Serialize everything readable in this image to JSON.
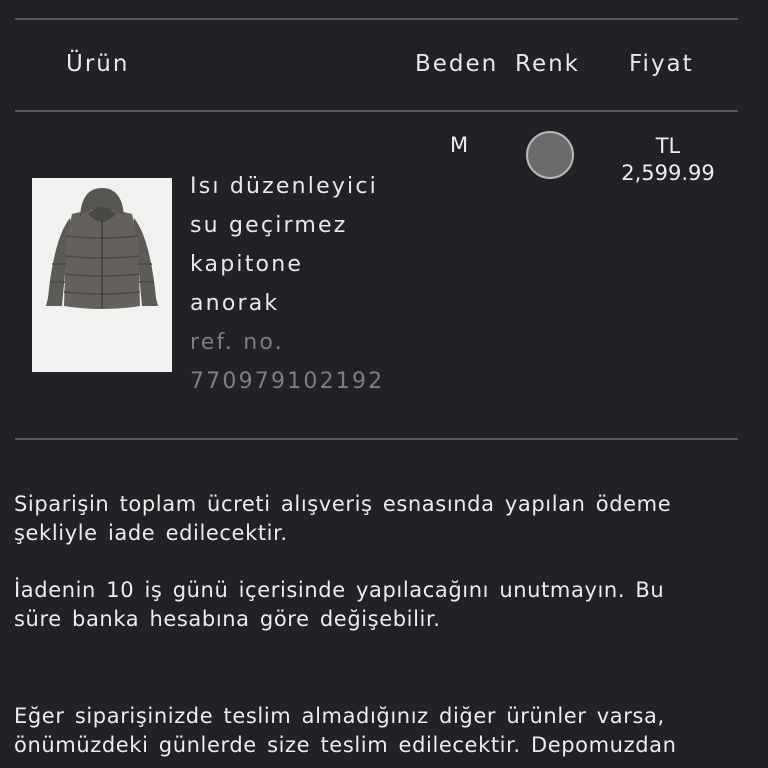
{
  "table": {
    "headers": {
      "product": "Ürün",
      "size": "Beden",
      "color": "Renk",
      "price": "Fiyat"
    }
  },
  "item": {
    "image_icon": "hooded-puffer-jacket",
    "name_lines": [
      "Isı düzenleyici",
      "su geçirmez",
      "kapitone",
      "anorak"
    ],
    "ref_label": "ref. no.",
    "ref_number": "770979102192",
    "size": "M",
    "color_swatch": "#6a6a6c",
    "currency": "TL",
    "price": "2,599.99"
  },
  "info": {
    "para1_line1": "Siparişin toplam ücreti alışveriş esnasında yapılan ödeme",
    "para1_line2": "şekliyle iade edilecektir.",
    "para2_line1": "İadenin 10 iş günü içerisinde yapılacağını unutmayın. Bu",
    "para2_line2": "süre banka hesabına göre değişebilir.",
    "para3_line1": "Eğer siparişinizde teslim almadığınız diğer ürünler varsa,",
    "para3_line2": "önümüzdeki günlerde size teslim edilecektir. Depomuzdan"
  },
  "colors": {
    "background": "#212226",
    "divider": "#55565a",
    "muted_text": "#7d7e82"
  }
}
